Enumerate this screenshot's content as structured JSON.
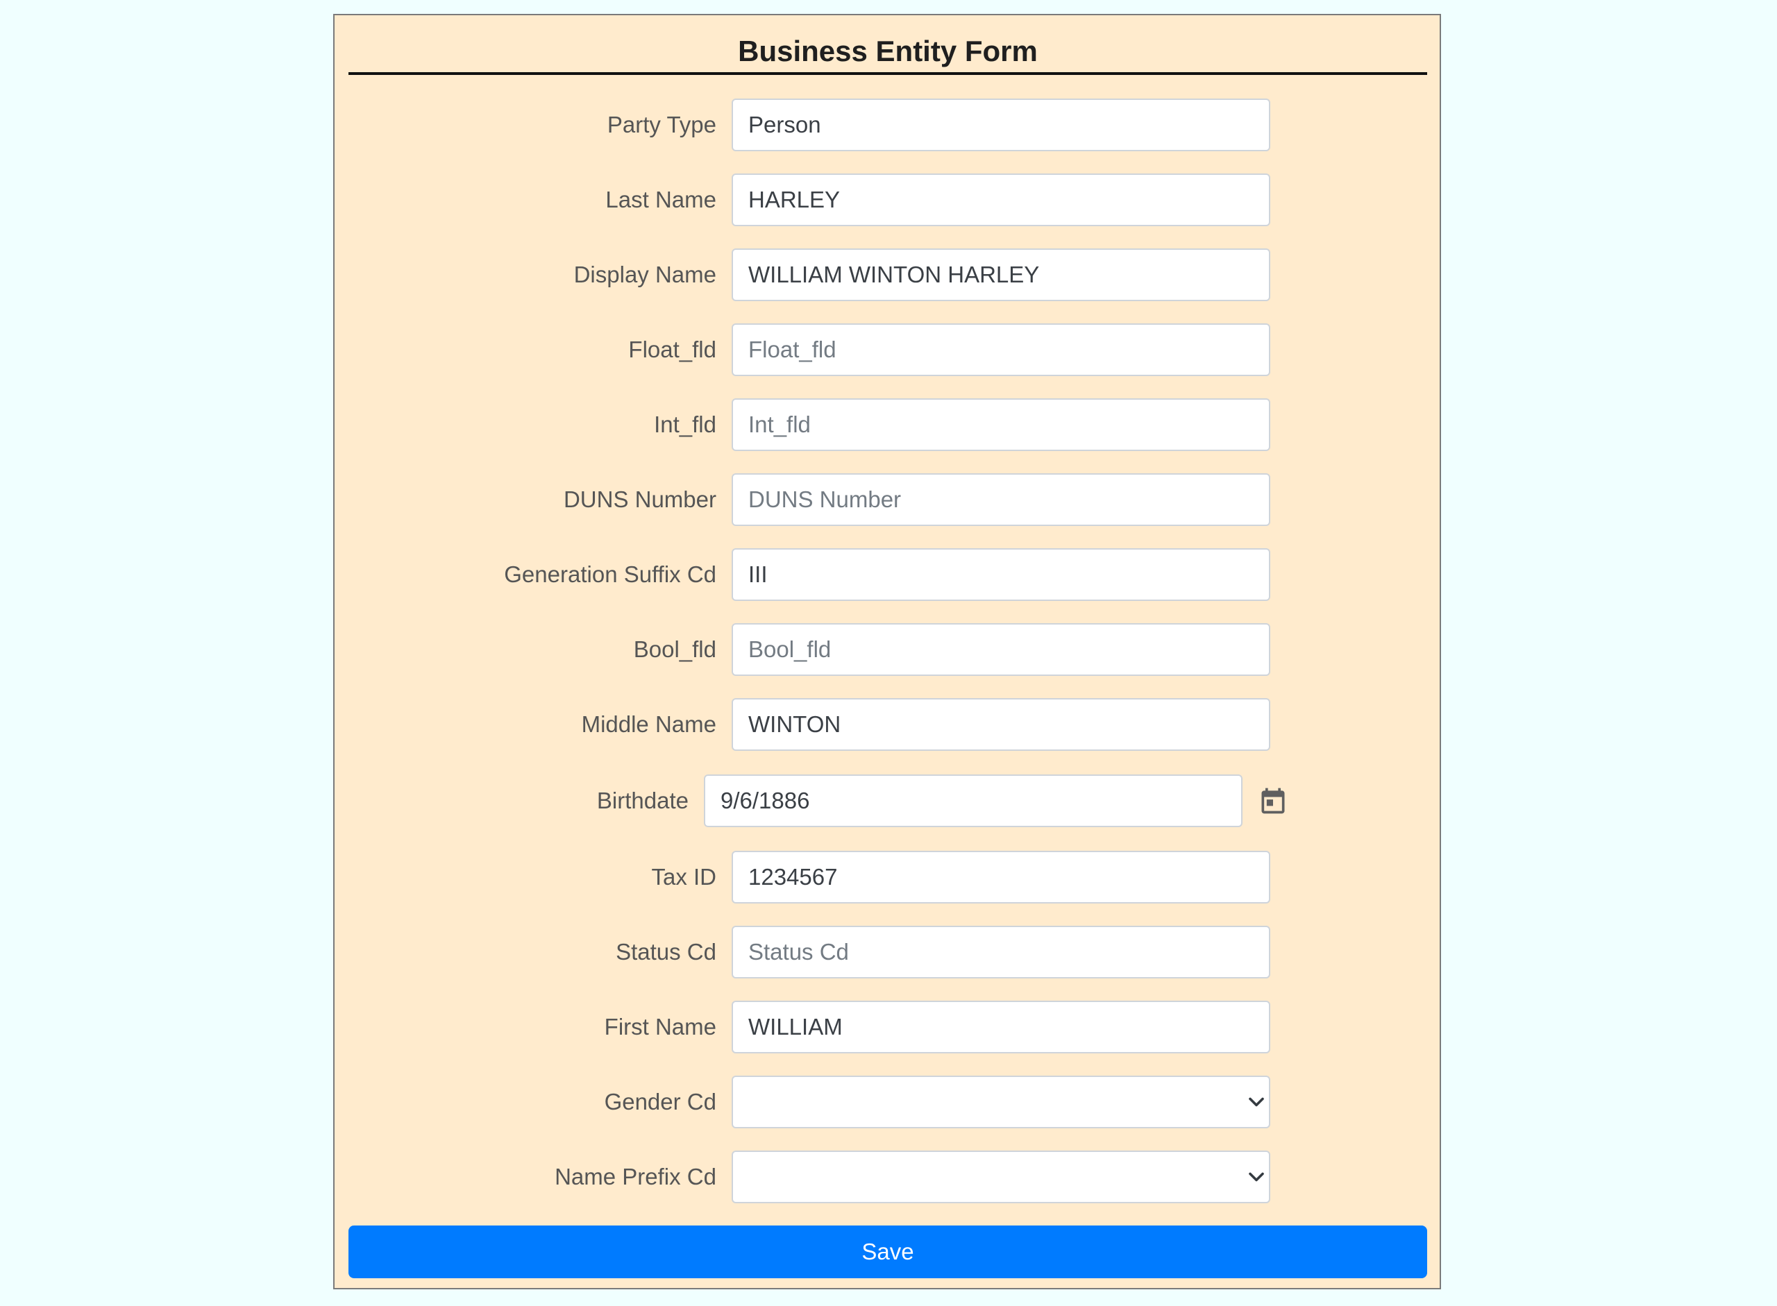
{
  "form": {
    "title": "Business Entity Form",
    "save_label": "Save",
    "fields": {
      "party_type": {
        "label": "Party Type",
        "value": "Person",
        "placeholder": "Party Type"
      },
      "last_name": {
        "label": "Last Name",
        "value": "HARLEY",
        "placeholder": "Last Name"
      },
      "display_name": {
        "label": "Display Name",
        "value": "WILLIAM WINTON HARLEY",
        "placeholder": "Display Name"
      },
      "float_fld": {
        "label": "Float_fld",
        "value": "",
        "placeholder": "Float_fld"
      },
      "int_fld": {
        "label": "Int_fld",
        "value": "",
        "placeholder": "Int_fld"
      },
      "duns_number": {
        "label": "DUNS Number",
        "value": "",
        "placeholder": "DUNS Number"
      },
      "generation_suffix": {
        "label": "Generation Suffix Cd",
        "value": "III",
        "placeholder": "Generation Suffix Cd"
      },
      "bool_fld": {
        "label": "Bool_fld",
        "value": "",
        "placeholder": "Bool_fld"
      },
      "middle_name": {
        "label": "Middle Name",
        "value": "WINTON",
        "placeholder": "Middle Name"
      },
      "birthdate": {
        "label": "Birthdate",
        "value": "9/6/1886",
        "placeholder": "Birthdate"
      },
      "tax_id": {
        "label": "Tax ID",
        "value": "1234567",
        "placeholder": "Tax ID"
      },
      "status_cd": {
        "label": "Status Cd",
        "value": "",
        "placeholder": "Status Cd"
      },
      "first_name": {
        "label": "First Name",
        "value": "WILLIAM",
        "placeholder": "First Name"
      },
      "gender_cd": {
        "label": "Gender Cd",
        "selected": ""
      },
      "name_prefix_cd": {
        "label": "Name Prefix Cd",
        "selected": ""
      }
    }
  },
  "icons": {
    "calendar": "calendar-icon",
    "select_arrow": "chevron-down-icon"
  },
  "colors": {
    "page_background": "#f0ffff",
    "form_background": "#ffebcd",
    "primary_button": "#007bff",
    "label_text": "#555555"
  }
}
